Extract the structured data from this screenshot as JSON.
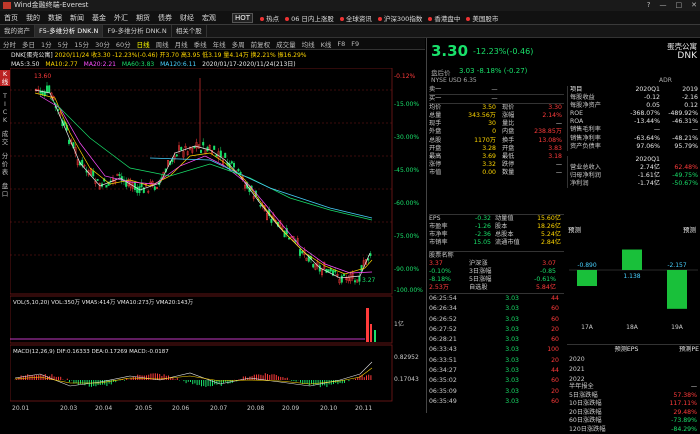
{
  "window": {
    "title": "Wind金融终端-Everest",
    "controls": [
      "?",
      "—",
      "□",
      "✕"
    ]
  },
  "menu": {
    "items": [
      "首页",
      "我的",
      "数据",
      "新闻",
      "基金",
      "外汇",
      "期货",
      "债券",
      "财经",
      "宏观"
    ],
    "hot_label": "HOT",
    "hot": [
      "热点",
      "06 日内上涨股",
      "全球资讯",
      "沪深300指数",
      "香港盘中",
      "美国股市"
    ]
  },
  "tabs": [
    {
      "label": "我的资产"
    },
    {
      "label": "F5-多维分析 DNK.N",
      "active": true
    },
    {
      "label": "F9-多维分析 DNK.N"
    },
    {
      "label": "相关个股"
    }
  ],
  "toolbar": {
    "items": [
      "分时",
      "多日",
      "1分",
      "5分",
      "15分",
      "30分",
      "60分",
      "日线",
      "周线",
      "月线",
      "季线",
      "年线",
      "多周",
      "前复权",
      "成交量",
      "均线",
      "K线",
      "F8",
      "F9"
    ],
    "active": "日线"
  },
  "chart_info": {
    "symbol": "DNK[蛋壳公寓]",
    "line1": "2020/11/24 收3.30 -12.23%(-0.46) 开3.70 高3.95 低3.19 量4.14万 换2.21% 振16.29%",
    "ma": [
      {
        "label": "MA5",
        "value": "3.50",
        "color": "#e8e8e8"
      },
      {
        "label": "MA10",
        "value": "2.77",
        "color": "#ffd700"
      },
      {
        "label": "MA20",
        "value": "2.21",
        "color": "#ff4dff"
      },
      {
        "label": "MA60",
        "value": "3.83",
        "color": "#19e06a"
      },
      {
        "label": "MA120",
        "value": "6.11",
        "color": "#48d1ff"
      }
    ],
    "range": "2020/01/17-2020/11/24(213日)"
  },
  "left_tabs": [
    "K",
    "线",
    "T",
    "I",
    "C",
    "K",
    "成",
    "交",
    "分",
    "价",
    "表",
    "盘",
    "口"
  ],
  "price_chart": {
    "y_labels": [
      "-0.12%",
      "-15.00%",
      "-30.00%",
      "-45.00%",
      "-60.00%",
      "-75.00%",
      "-90.00%",
      "-100.00%"
    ],
    "left_marks": [
      "13.60",
      "3.27"
    ],
    "x_labels": [
      "20.01",
      "20.03",
      "20.04",
      "20.05",
      "20.06",
      "20.07",
      "20.08",
      "20.09",
      "20.10",
      "20.11"
    ],
    "left_y": [
      "10.00",
      "1.27"
    ]
  },
  "vol_chart": {
    "header": "VOL(5,10,20)  VOL:350万  VMA5:414万  VMA10:273万  VMA20:143万",
    "y_labels": [
      "1亿"
    ]
  },
  "macd_chart": {
    "header": "MACD(12,26,9)  DIF:0.16333  DEA:0.17269  MACD:-0.0187",
    "y_labels": [
      "0.82952",
      "0.17043"
    ]
  },
  "quote": {
    "price": "3.30",
    "change": "-12.23%(-0.46)",
    "name": "蛋壳公寓",
    "ticker": "DNK",
    "after_hours_label": "盘后价",
    "after_hours": "3.03  -8.18%  (-0.27)",
    "exch": "NYSE USD 6.35",
    "adr": "ADR"
  },
  "orderbook": {
    "sell": {
      "label": "卖一",
      "price": "—",
      "vol": ""
    },
    "buy": {
      "label": "买一",
      "price": "—",
      "vol": ""
    }
  },
  "stats": [
    [
      "均价",
      "3.50",
      "现价",
      "3.30"
    ],
    [
      "总量",
      "343.56万",
      "涨幅",
      "2.14%"
    ],
    [
      "现手",
      "30",
      "量比",
      "—"
    ],
    [
      "外盘",
      "0",
      "内盘",
      "238.85万"
    ],
    [
      "总股",
      "1170万",
      "换手",
      "13.08%"
    ],
    [
      "开盘",
      "3.28",
      "开盘",
      "3.83"
    ],
    [
      "最高",
      "3.69",
      "最低",
      "3.18"
    ],
    [
      "涨停",
      "3.32",
      "跌停",
      "—"
    ],
    [
      "市值",
      "0.00",
      "数量",
      "—"
    ]
  ],
  "fundamentals": [
    [
      "EPS",
      "-0.32",
      "动量值",
      "15.60亿"
    ],
    [
      "市盈率",
      "-1.26",
      "股本",
      "18.26亿"
    ],
    [
      "市净率",
      "-2.36",
      "总股本",
      "5.24亿"
    ],
    [
      "市销率",
      "15.05",
      "流通市值",
      "2.84亿"
    ]
  ],
  "industry_header": "股票名称",
  "industry": [
    [
      "3.37",
      "沪深涨",
      "3.07"
    ],
    [
      "-0.10%",
      "3日涨幅",
      "-0.85"
    ],
    [
      "-8.18%",
      "5日涨幅",
      "-0.61%"
    ],
    [
      "2.53万",
      "自选股",
      "5.84亿"
    ]
  ],
  "report": {
    "header": [
      "项目",
      "2020Q1",
      "2019"
    ],
    "rows": [
      [
        "每股收益",
        "-0.12",
        "-2.16"
      ],
      [
        "每股净资产",
        "0.05",
        "0.12"
      ],
      [
        "ROE",
        "-368.07%",
        "-489.92%"
      ],
      [
        "ROA",
        "-13.44%",
        "-46.31%"
      ],
      [
        "销售毛利率",
        "—",
        "—"
      ],
      [
        "销售净利率",
        "-63.64%",
        "-48.21%"
      ],
      [
        "资产负债率",
        "97.06%",
        "95.79%"
      ]
    ],
    "fin_header": [
      "",
      "2020Q1",
      ""
    ],
    "fin_rows": [
      [
        "营业总收入",
        "2.74亿",
        "62.48%"
      ],
      [
        "归母净利润",
        "-1.61亿",
        "-49.75%"
      ],
      [
        "净利润",
        "-1.74亿",
        "-50.67%"
      ]
    ],
    "forecast_label": "预测",
    "forecast_right": "预测",
    "bars": [
      {
        "period": "17A",
        "value": -0.89
      },
      {
        "period": "18A",
        "value": 1.138
      },
      {
        "period": "19A",
        "value": -2.157
      }
    ],
    "eps_header": [
      "",
      "预测EPS",
      "预测PE"
    ],
    "eps_rows": [
      [
        "2020",
        "",
        ""
      ],
      [
        "2021",
        "",
        ""
      ],
      [
        "2022",
        "",
        ""
      ]
    ]
  },
  "ticks": [
    [
      "06:25:54",
      "3.03",
      "44"
    ],
    [
      "06:26:34",
      "3.03",
      "60"
    ],
    [
      "06:26:52",
      "3.03",
      "60"
    ],
    [
      "06:27:52",
      "3.03",
      "20"
    ],
    [
      "06:28:21",
      "3.03",
      "60"
    ],
    [
      "06:33:43",
      "3.03",
      "100"
    ],
    [
      "06:33:51",
      "3.03",
      "20"
    ],
    [
      "06:34:27",
      "3.03",
      "44"
    ],
    [
      "06:35:02",
      "3.03",
      "60"
    ],
    [
      "06:35:09",
      "3.03",
      "20"
    ],
    [
      "06:35:49",
      "3.03",
      "60"
    ]
  ],
  "periods": [
    [
      "半年报全",
      "—"
    ],
    [
      "5日涨跌幅",
      "57.38%"
    ],
    [
      "10日涨跌幅",
      "117.11%"
    ],
    [
      "20日涨跌幅",
      "29.48%"
    ],
    [
      "60日涨跌幅",
      "-73.89%"
    ],
    [
      "120日涨跌幅",
      "-84.29%"
    ]
  ]
}
